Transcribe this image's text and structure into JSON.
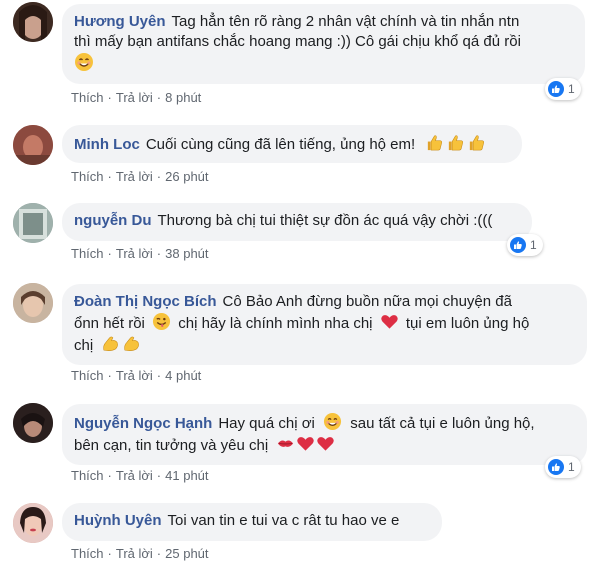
{
  "comments": [
    {
      "name": "Hương Uyên",
      "text_line1": "Tag hẳn tên rõ ràng 2 nhân vật chính và tin nhắn ntn",
      "text_line2": "thì mấy bạn antifans chắc hoang mang :)) Cô gái chịu khổ qá đủ rồi",
      "like_label": "Thích",
      "reply_label": "Trả lời",
      "time": "8 phút",
      "reaction_count": "1",
      "avatar_color": "#5b3a2e"
    },
    {
      "name": "Minh Loc",
      "text_line1": "Cuối cùng cũng đã lên tiếng, ủng hộ em!",
      "like_label": "Thích",
      "reply_label": "Trả lời",
      "time": "26 phút",
      "reaction_count": "",
      "avatar_color": "#a0524a"
    },
    {
      "name": "nguyễn Du",
      "text_line1": "Thương bà chị tui thiệt sự đồn ác quá vậy chời :(((",
      "like_label": "Thích",
      "reply_label": "Trả lời",
      "time": "38 phút",
      "reaction_count": "1",
      "avatar_color": "#7d8f8a"
    },
    {
      "name": "Đoàn Thị Ngọc Bích",
      "text_line1": "Cô Bảo Anh đừng buồn nữa mọi chuyện đã",
      "text_line2": "ổnn hết rồi",
      "text_line2b": "chị hãy là chính mình nha chị",
      "text_line2c": "tụi em luôn ủng hộ",
      "text_line3": "chị",
      "like_label": "Thích",
      "reply_label": "Trả lời",
      "time": "4 phút",
      "reaction_count": "",
      "avatar_color": "#b59a84"
    },
    {
      "name": "Nguyễn Ngọc Hạnh",
      "text_line1": "Hay quá chị ơi",
      "text_line1b": "sau tất cả tụi e luôn ủng hộ,",
      "text_line2": "bên cạn, tin tưởng và yêu chị",
      "like_label": "Thích",
      "reply_label": "Trả lời",
      "time": "41 phút",
      "reaction_count": "1",
      "avatar_color": "#3a2a28"
    },
    {
      "name": "Huỳnh Uyên",
      "text_line1": "Toi van tin e tui va c rât tu hao ve e",
      "like_label": "Thích",
      "reply_label": "Trả lời",
      "time": "25 phút",
      "reaction_count": "",
      "avatar_color": "#c98f87"
    }
  ],
  "icons": {
    "reaction": "like-thumb-icon",
    "smile": "smiling-face-emoji",
    "thumbs": "thumbs-up-emoji",
    "wink": "winking-tongue-emoji",
    "heart": "red-heart-emoji",
    "muscle": "flexed-biceps-emoji",
    "kiss": "kiss-lips-emoji"
  },
  "colors": {
    "name": "#385898",
    "bubble": "#f2f3f5",
    "like": "#1877f2"
  }
}
